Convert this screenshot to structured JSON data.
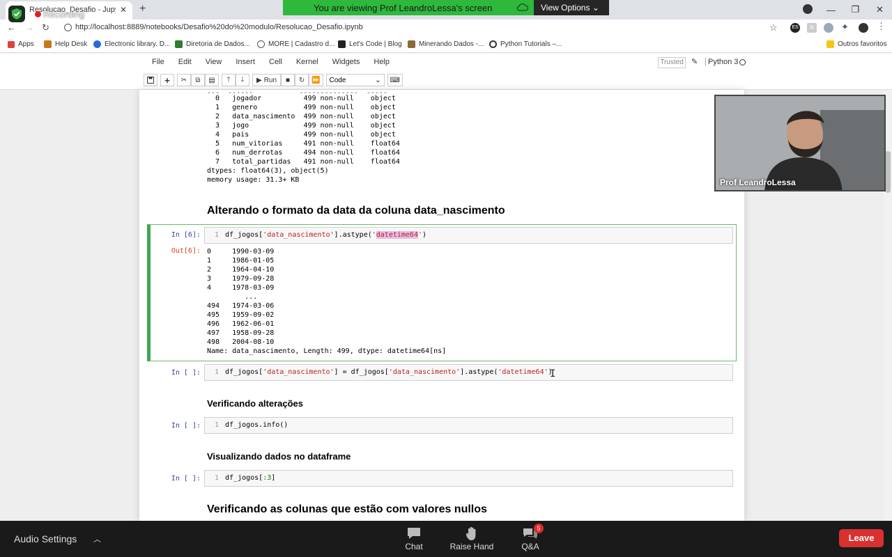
{
  "browser": {
    "tab_title": "Resolucao_Desafio - Jupyter Notebook",
    "url": "http://localhost:8889/notebooks/Desafio%20do%20modulo/Resolucao_Desafio.ipynb",
    "bookmarks": [
      "Apps",
      "Help Desk",
      "Electronic library. D...",
      "Diretoria de Dados...",
      "MORE | Cadastro d...",
      "Let's Code | Blog",
      "Minerando Dados -...",
      "Python Tutorials –..."
    ],
    "other_bookmarks": "Outros favoritos",
    "extension_es": "ES",
    "extension_n": "N"
  },
  "recording": {
    "label": "Recording"
  },
  "share_banner": {
    "message": "You are viewing Prof LeandroLessa's screen",
    "view_options": "View Options ⌄"
  },
  "jupyter": {
    "menu": [
      "File",
      "Edit",
      "View",
      "Insert",
      "Cell",
      "Kernel",
      "Widgets",
      "Help"
    ],
    "trusted": "Trusted",
    "kernel": "Python 3",
    "run_label": "Run",
    "cell_type": "Code"
  },
  "notebook": {
    "info_output": "  0   jogador          499 non-null    object \n  1   genero           499 non-null    object \n  2   data_nascimento  499 non-null    object \n  3   jogo             499 non-null    object \n  4   pais             499 non-null    object \n  5   num_vitorias     491 non-null    float64\n  6   num_derrotas     494 non-null    float64\n  7   total_partidas   491 non-null    float64\ndtypes: float64(3), object(5)\nmemory usage: 31.3+ KB",
    "heading1": "Alterando o formato da data da coluna data_nascimento",
    "cell6": {
      "in_prompt": "In [6]:",
      "line_no": "1",
      "code_prefix": "df_jogos[",
      "code_str1": "'data_nascimento'",
      "code_mid": "].astype(",
      "code_q1": "'",
      "code_hl": "datetime64",
      "code_q2": "'",
      "code_suffix": ")",
      "out_prompt": "Out[6]:",
      "output": "0     1990-03-09\n1     1986-01-05\n2     1964-04-10\n3     1979-09-28\n4     1978-03-09\n         ...    \n494   1974-03-06\n495   1959-09-02\n496   1962-06-01\n497   1958-09-28\n498   2004-08-10\nName: data_nascimento, Length: 499, dtype: datetime64[ns]"
    },
    "cell7": {
      "in_prompt": "In [ ]:",
      "line_no": "1",
      "code_a": "df_jogos[",
      "code_s1": "'data_nascimento'",
      "code_b": "] = df_jogos[",
      "code_s2": "'data_nascimento'",
      "code_c": "].astype(",
      "code_s3": "'datetime64'",
      "code_d": ")"
    },
    "heading2": "Verificando alterações",
    "cell8": {
      "in_prompt": "In [ ]:",
      "line_no": "1",
      "code": "df_jogos.info()"
    },
    "heading3": "Visualizando dados no dataframe",
    "cell9": {
      "in_prompt": "In [ ]:",
      "line_no": "1",
      "code_a": "df_jogos[",
      "code_b": ":3",
      "code_c": "]"
    },
    "heading4": "Verificando as colunas que estão com valores nullos"
  },
  "webcam": {
    "name": "Prof LeandroLessa"
  },
  "zoom": {
    "audio_settings": "Audio Settings",
    "chat": "Chat",
    "raise_hand": "Raise Hand",
    "qa": "Q&A",
    "qa_badge": "5",
    "leave": "Leave"
  }
}
